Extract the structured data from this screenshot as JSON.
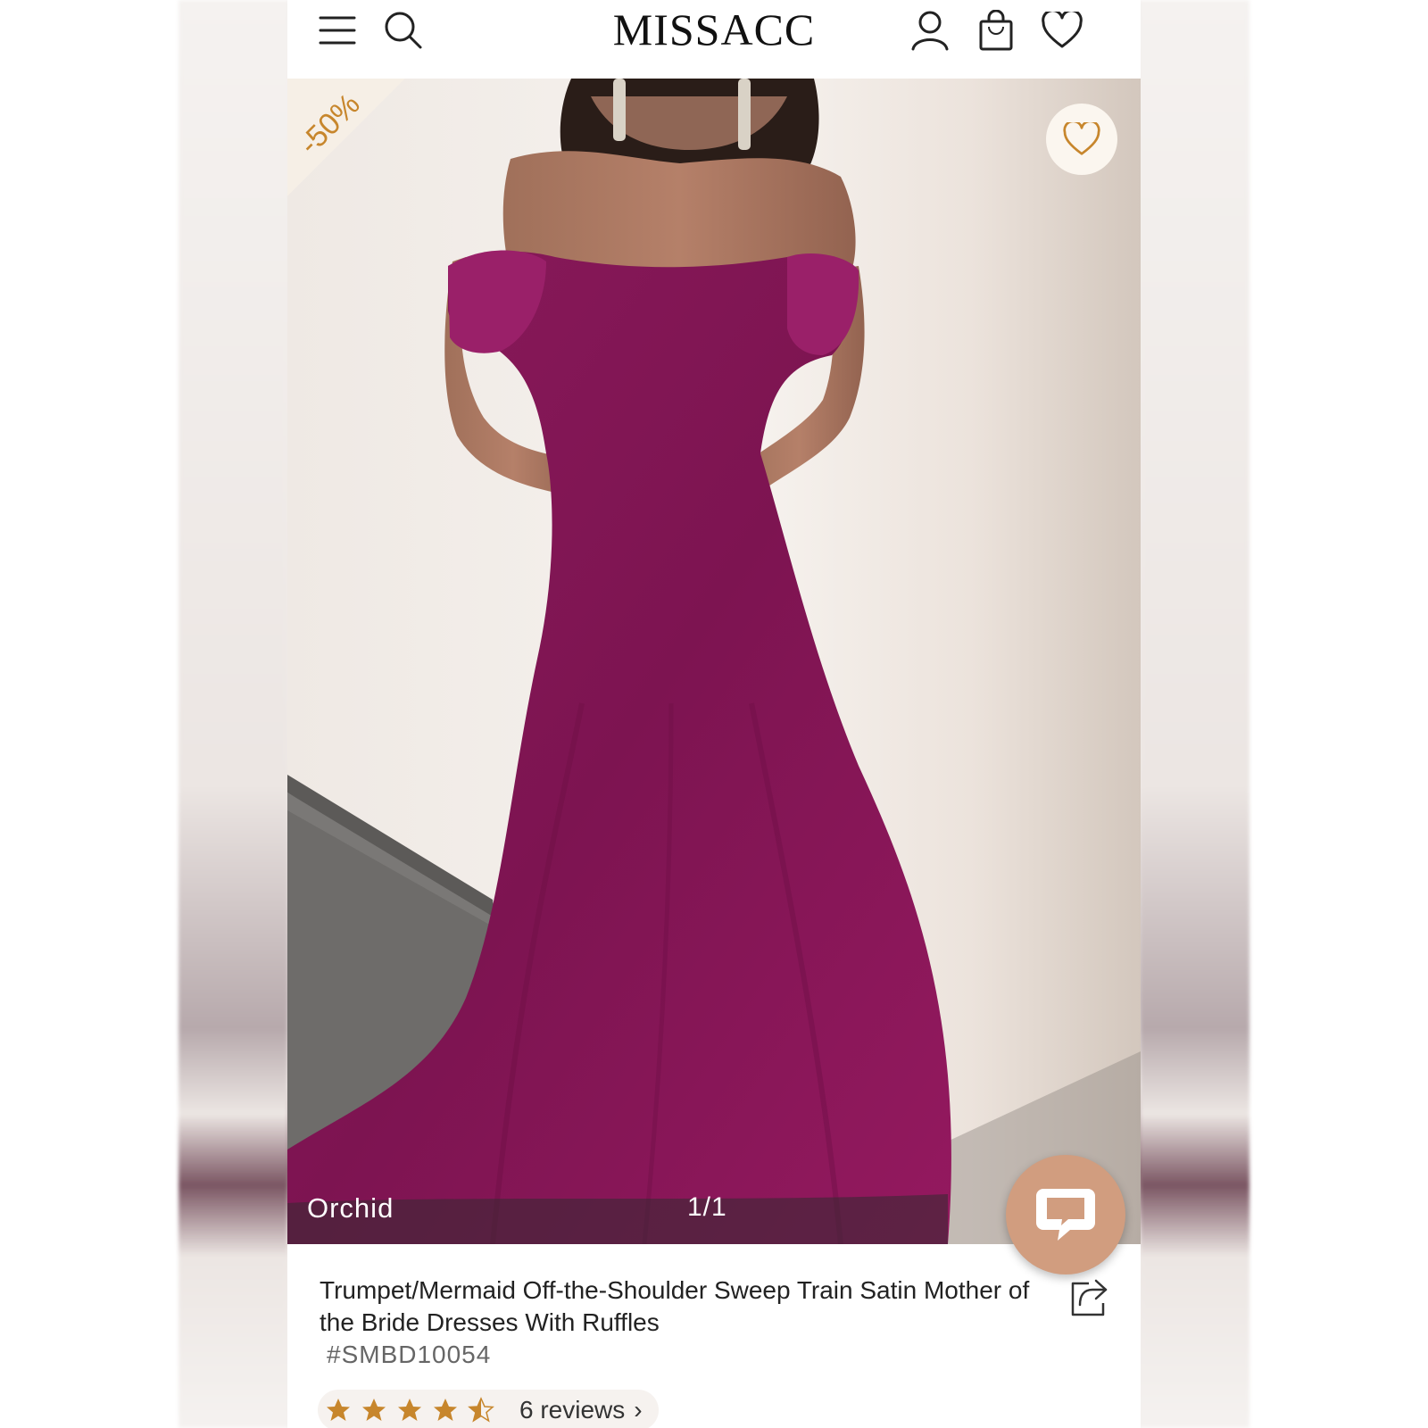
{
  "header": {
    "brand": "MISSACC",
    "icons": [
      "menu-icon",
      "search-icon",
      "account-icon",
      "bag-icon",
      "wishlist-icon"
    ]
  },
  "product_image": {
    "discount_badge": "-50%",
    "color_label": "Orchid",
    "image_counter": "1/1",
    "wishlist_icon": "heart-icon"
  },
  "chat": {
    "icon": "chat-bubble-icon"
  },
  "product": {
    "title": "Trumpet/Mermaid Off-the-Shoulder Sweep Train Satin Mother of the Bride Dresses With Ruffles",
    "sku": "#SMBD10054",
    "rating": 4.5,
    "reviews_label": "6 reviews",
    "reviews_chevron": "›"
  },
  "colors": {
    "accent": "#c7862c",
    "chat_button": "#d19d7f",
    "dress": "#8e1a5e"
  }
}
